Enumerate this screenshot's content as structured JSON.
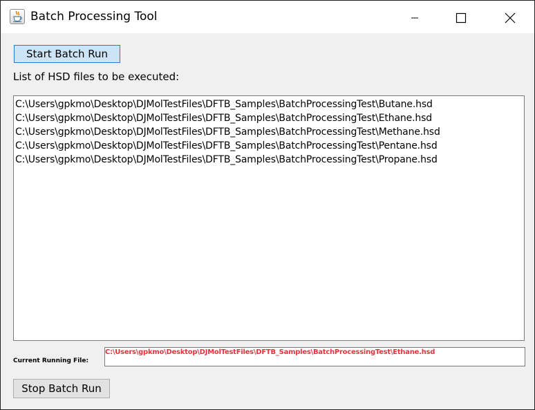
{
  "window": {
    "title": "Batch Processing Tool",
    "app_icon": "java-cup-icon",
    "controls": [
      "minimize-icon",
      "maximize-icon",
      "close-icon"
    ]
  },
  "toolbar": {
    "start_label": "Start Batch Run",
    "stop_label": "Stop Batch Run"
  },
  "file_list": {
    "label": "List of HSD files to be executed:",
    "items": [
      "C:\\Users\\gpkmo\\Desktop\\DJMolTestFiles\\DFTB_Samples\\BatchProcessingTest\\Butane.hsd",
      "C:\\Users\\gpkmo\\Desktop\\DJMolTestFiles\\DFTB_Samples\\BatchProcessingTest\\Ethane.hsd",
      "C:\\Users\\gpkmo\\Desktop\\DJMolTestFiles\\DFTB_Samples\\BatchProcessingTest\\Methane.hsd",
      "C:\\Users\\gpkmo\\Desktop\\DJMolTestFiles\\DFTB_Samples\\BatchProcessingTest\\Pentane.hsd",
      "C:\\Users\\gpkmo\\Desktop\\DJMolTestFiles\\DFTB_Samples\\BatchProcessingTest\\Propane.hsd"
    ]
  },
  "status": {
    "label": "Current Running File:",
    "value": "C:\\Users\\gpkmo\\Desktop\\DJMolTestFiles\\DFTB_Samples\\BatchProcessingTest\\Ethane.hsd",
    "value_color": "#e8323c"
  },
  "colors": {
    "window_bg": "#f0f0f0",
    "start_button_bg": "#cde4f7",
    "start_button_border": "#2d78c9"
  }
}
